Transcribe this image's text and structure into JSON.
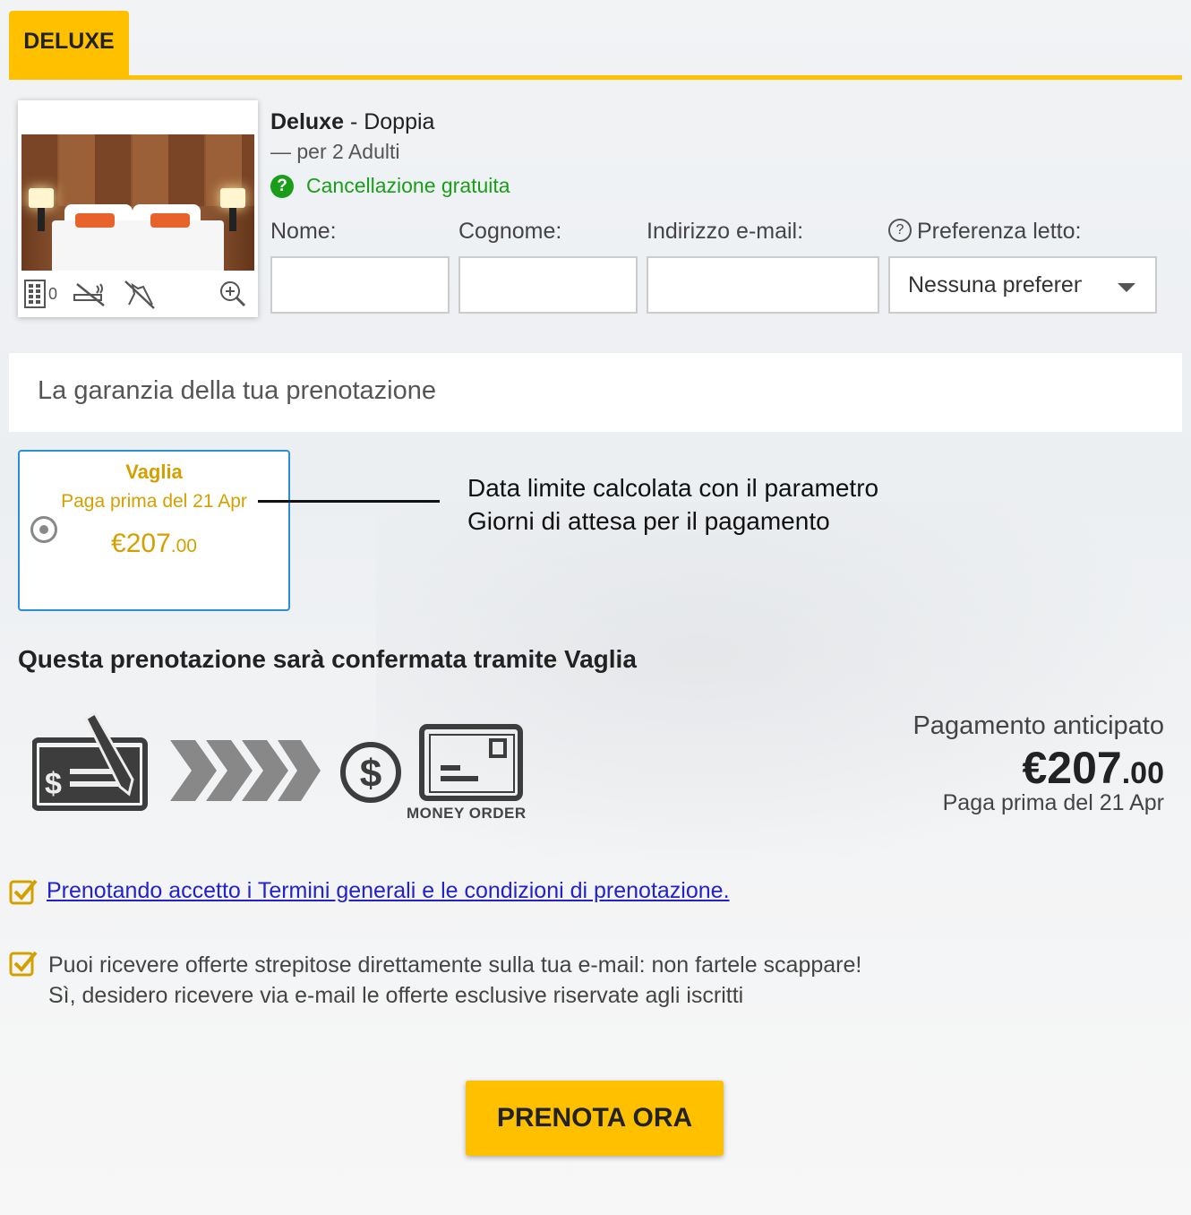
{
  "colors": {
    "accent": "#ffc000",
    "success": "#1a9e1a",
    "price": "#d4a000",
    "selected_border": "#2b8fd6",
    "link": "#2222cc"
  },
  "tab": {
    "label": "DELUXE"
  },
  "room": {
    "name": "Deluxe",
    "type_separator": "- Doppia",
    "occupancy": "— per 2 Adulti",
    "cancellation": "Cancellazione gratuita",
    "floor_count": "0",
    "icons": [
      "building-icon",
      "no-smoking-icon",
      "no-pets-icon",
      "zoom-icon"
    ]
  },
  "form": {
    "first_name_label": "Nome:",
    "last_name_label": "Cognome:",
    "email_label": "Indirizzo e-mail:",
    "bed_pref_label": "Preferenza letto:",
    "bed_pref_value": "Nessuna preferenza"
  },
  "guarantee": {
    "title": "La garanzia della tua prenotazione"
  },
  "payment_option": {
    "name": "Vaglia",
    "deadline": "Paga prima del 21 Apr",
    "price_main": "€207",
    "price_cents": ".00"
  },
  "annotation": {
    "line1": "Data limite calcolata con il parametro",
    "line2": "Giorni di attesa per il pagamento"
  },
  "confirmation": {
    "title": "Questa prenotazione sarà confermata tramite Vaglia",
    "money_order_label": "MONEY ORDER"
  },
  "advance": {
    "label": "Pagamento anticipato",
    "price_main": "€207",
    "price_cents": ".00",
    "deadline": "Paga prima del 21 Apr"
  },
  "terms": {
    "text": "Prenotando accetto i Termini generali e le condizioni di prenotazione."
  },
  "newsletter": {
    "line1": "Puoi ricevere offerte strepitose direttamente sulla tua e-mail: non fartele scappare!",
    "line2": "Sì, desidero ricevere via e-mail le offerte esclusive riservate agli iscritti"
  },
  "cta": {
    "label": "PRENOTA ORA"
  }
}
